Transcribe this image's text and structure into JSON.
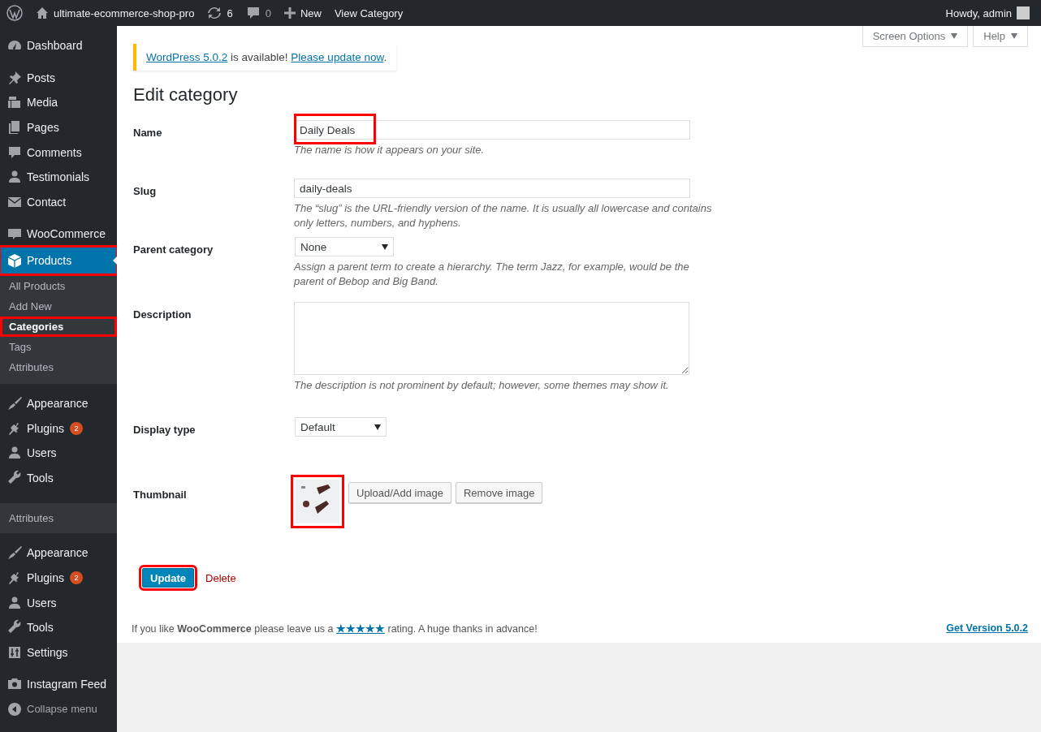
{
  "admin_bar": {
    "site_name": "ultimate-ecommerce-shop-pro",
    "updates": "6",
    "comments": "0",
    "new": "New",
    "view": "View Category",
    "greeting": "Howdy, admin"
  },
  "sidebar": {
    "items": [
      {
        "kind": "menu",
        "label": "Dashboard",
        "current": false,
        "highlighted": false
      },
      {
        "kind": "separator"
      },
      {
        "kind": "menu",
        "label": "Posts",
        "current": false,
        "highlighted": false
      },
      {
        "kind": "menu",
        "label": "Media",
        "current": false,
        "highlighted": false
      },
      {
        "kind": "menu",
        "label": "Pages",
        "current": false,
        "highlighted": false
      },
      {
        "kind": "menu",
        "label": "Comments",
        "current": false,
        "highlighted": false
      },
      {
        "kind": "menu",
        "label": "Testimonials",
        "current": false,
        "highlighted": false
      },
      {
        "kind": "menu",
        "label": "Contact",
        "current": false,
        "highlighted": false
      },
      {
        "kind": "separator"
      },
      {
        "kind": "menu",
        "label": "WooCommerce",
        "current": false,
        "highlighted": false
      },
      {
        "kind": "menu",
        "label": "Products",
        "current": true,
        "highlighted": true,
        "children": [
          {
            "label": "All Products",
            "selected": false,
            "highlighted": false
          },
          {
            "label": "Add New",
            "selected": false,
            "highlighted": false
          },
          {
            "label": "Categories",
            "selected": true,
            "highlighted": true
          },
          {
            "label": "Tags",
            "selected": false,
            "highlighted": false
          },
          {
            "label": "Attributes",
            "selected": false,
            "highlighted": false
          }
        ]
      },
      {
        "kind": "separator"
      },
      {
        "kind": "menu",
        "label": "Appearance",
        "current": false,
        "highlighted": false
      },
      {
        "kind": "menu",
        "label": "Plugins",
        "current": false,
        "highlighted": false,
        "badge": "2"
      },
      {
        "kind": "menu",
        "label": "Users",
        "current": false,
        "highlighted": false
      },
      {
        "kind": "menu",
        "label": "Tools",
        "current": false,
        "highlighted": false
      },
      {
        "kind": "band",
        "label": "Attributes"
      },
      {
        "kind": "separator"
      },
      {
        "kind": "menu",
        "label": "Appearance",
        "current": false,
        "highlighted": false
      },
      {
        "kind": "menu",
        "label": "Plugins",
        "current": false,
        "highlighted": false,
        "badge": "2"
      },
      {
        "kind": "menu",
        "label": "Users",
        "current": false,
        "highlighted": false
      },
      {
        "kind": "menu",
        "label": "Tools",
        "current": false,
        "highlighted": false
      },
      {
        "kind": "menu",
        "label": "Settings",
        "current": false,
        "highlighted": false
      },
      {
        "kind": "separator"
      },
      {
        "kind": "menu",
        "label": "Instagram Feed",
        "current": false,
        "highlighted": false
      },
      {
        "kind": "collapse",
        "label": "Collapse menu"
      }
    ]
  },
  "screen_meta": {
    "buttons": [
      "Screen Options",
      "Help"
    ]
  },
  "notice": {
    "parts": [
      {
        "text": "WordPress 5.0.2",
        "kind": "link"
      },
      {
        "text": " is available! ",
        "kind": "text"
      },
      {
        "text": "Please update now",
        "kind": "link"
      },
      {
        "text": ".",
        "kind": "text"
      }
    ]
  },
  "page_title": "Edit category",
  "form": {
    "rows": [
      {
        "kind": "text",
        "label": "Name",
        "value": "Daily Deals",
        "highlighted": true,
        "description": "The name is how it appears on your site."
      },
      {
        "kind": "text",
        "label": "Slug",
        "value": "daily-deals",
        "highlighted": false,
        "description": "The “slug” is the URL-friendly version of the name. It is usually all lowercase and contains only letters, numbers, and hyphens."
      },
      {
        "kind": "select",
        "label": "Parent category",
        "value": "None",
        "description": "Assign a parent term to create a hierarchy. The term Jazz, for example, would be the parent of Bebop and Big Band."
      },
      {
        "kind": "textarea",
        "label": "Description",
        "description": "The description is not prominent by default; however, some themes may show it."
      },
      {
        "kind": "select",
        "label": "Display type",
        "value": "Default"
      },
      {
        "kind": "thumbnail",
        "label": "Thumbnail",
        "highlighted": true,
        "buttons": [
          "Upload/Add image",
          "Remove image"
        ]
      }
    ]
  },
  "actions": {
    "update": "Update",
    "update_highlighted": true,
    "delete": "Delete"
  },
  "footer": {
    "parts": [
      {
        "text": "If you like ",
        "kind": "text"
      },
      {
        "text": "WooCommerce",
        "kind": "bold"
      },
      {
        "text": " please leave us a ",
        "kind": "text"
      },
      {
        "text": "★★★★★",
        "kind": "link"
      },
      {
        "text": " rating. A huge thanks in advance!",
        "kind": "text"
      }
    ],
    "version_link": "Get Version 5.0.2"
  }
}
